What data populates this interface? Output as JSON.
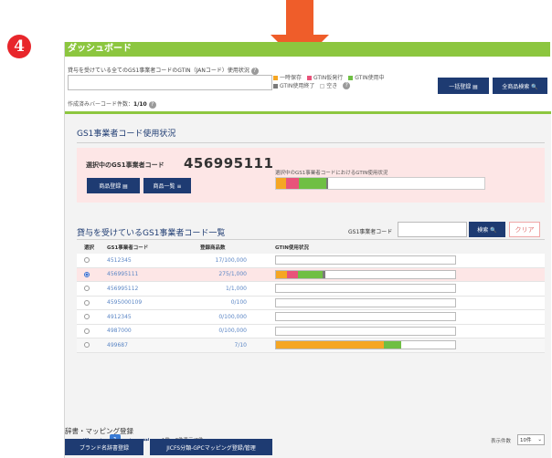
{
  "step_number": "4",
  "header": {
    "title": "ダッシュボード"
  },
  "usage": {
    "line": "貸与を受けている全てのGS1事業者コードのGTIN（JANコード）使用状況",
    "help": "?",
    "made_count_label": "作成済みバーコード件数：",
    "made_count_value": "1/10",
    "legend": [
      {
        "label": "一時保存",
        "color": "#f5a623"
      },
      {
        "label": "GTIN仮発行",
        "color": "#e8537a"
      },
      {
        "label": "GTIN使用中",
        "color": "#6fbf44"
      },
      {
        "label": "GTIN使用終了",
        "color": "#7a7a7a"
      },
      {
        "label": "空き",
        "color": "#ffffff"
      }
    ]
  },
  "toolbar": {
    "bulk_register": "一括登録 ▤",
    "search_all": "全商品検索 🔍"
  },
  "gs1_status": {
    "title": "GS1事業者コード使用状況",
    "selected_label": "選択中のGS1事業者コード",
    "selected_code": "456995111",
    "product_register": "商品登録 ▤",
    "product_list": "商品一覧 ≡",
    "usage_label": "選択中のGS1事業者コードにおけるGTIN使用状況",
    "usage_bar": [
      {
        "status": "一時保存",
        "fraction": 0.05,
        "color": "#f5a623"
      },
      {
        "status": "GTIN仮発行",
        "fraction": 0.06,
        "color": "#e8537a"
      },
      {
        "status": "GTIN使用中",
        "fraction": 0.13,
        "color": "#6fbf44"
      },
      {
        "status": "GTIN使用終了",
        "fraction": 0.01,
        "color": "#7a7a7a"
      }
    ]
  },
  "code_list": {
    "title": "貸与を受けているGS1事業者コード一覧",
    "search_label": "GS1事業者コード",
    "search_value": "",
    "search_button": "検索 🔍",
    "clear_button": "クリア",
    "columns": [
      "選択",
      "GS1事業者コード",
      "登録商品数",
      "GTIN使用状況"
    ],
    "rows": [
      {
        "code": "4512345",
        "count": "17/100,000",
        "selected": false,
        "bar": []
      },
      {
        "code": "456995111",
        "count": "275/1,000",
        "selected": true,
        "bar": [
          {
            "fraction": 0.06,
            "color": "#f5a623"
          },
          {
            "fraction": 0.06,
            "color": "#e8537a"
          },
          {
            "fraction": 0.14,
            "color": "#6fbf44"
          },
          {
            "fraction": 0.015,
            "color": "#7a7a7a"
          }
        ]
      },
      {
        "code": "456995112",
        "count": "1/1,000",
        "selected": false,
        "bar": []
      },
      {
        "code": "4595000109",
        "count": "0/100",
        "selected": false,
        "bar": []
      },
      {
        "code": "4912345",
        "count": "0/100,000",
        "selected": false,
        "bar": []
      },
      {
        "code": "4987000",
        "count": "0/100,000",
        "selected": false,
        "bar": []
      },
      {
        "code": "499687",
        "count": "7/10",
        "selected": false,
        "bar": [
          {
            "fraction": 0.6,
            "color": "#f5a623"
          },
          {
            "fraction": 0.1,
            "color": "#6fbf44"
          }
        ]
      }
    ]
  },
  "pager": {
    "first": "⏮",
    "prev": "‹",
    "current": "1",
    "next": "›",
    "last": "⏭",
    "info": "1件〜7件表示/7件",
    "per_page_label": "表示件数",
    "per_page_value": "10件"
  },
  "mapping": {
    "title": "辞書・マッピング登録",
    "brand_button": "ブランド名辞書登録",
    "gpc_button": "JICFS分類-GPCマッピング登録/管理"
  }
}
